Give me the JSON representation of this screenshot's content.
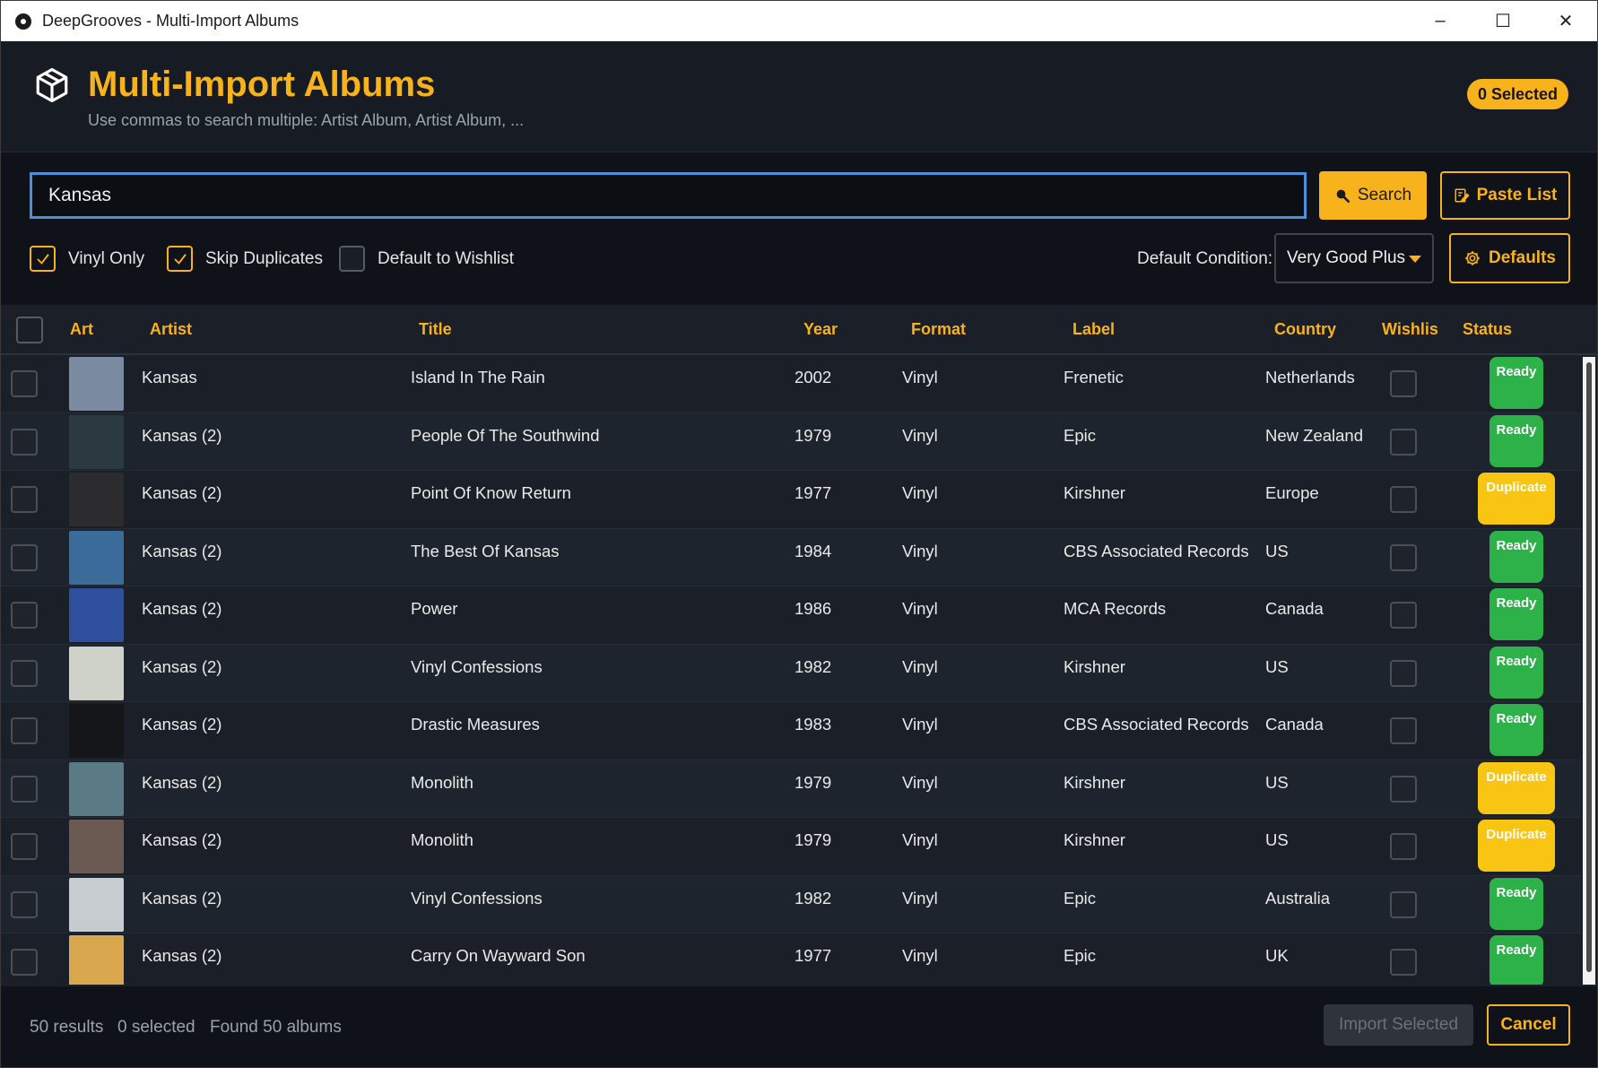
{
  "window": {
    "title": "DeepGrooves - Multi-Import Albums",
    "controls": {
      "minimize": "–",
      "maximize": "☐",
      "close": "✕"
    }
  },
  "header": {
    "title": "Multi-Import Albums",
    "subtitle": "Use commas to search multiple: Artist Album, Artist Album, ...",
    "selected_badge": "0 Selected",
    "icon": "package-icon"
  },
  "search": {
    "value": "Kansas",
    "button_label": "Search",
    "paste_label": "Paste List"
  },
  "options": {
    "vinyl_only": {
      "label": "Vinyl Only",
      "checked": true
    },
    "skip_duplicates": {
      "label": "Skip Duplicates",
      "checked": true
    },
    "default_wishlist": {
      "label": "Default to Wishlist",
      "checked": false
    },
    "condition_label": "Default Condition:",
    "condition_value": "Very Good Plus",
    "defaults_label": "Defaults"
  },
  "table": {
    "headers": [
      "Art",
      "Artist",
      "Title",
      "Year",
      "Format",
      "Label",
      "Country",
      "Wishlist",
      "Status"
    ],
    "rows": [
      {
        "artist": "Kansas",
        "title": "Island In The Rain",
        "year": "2002",
        "format": "Vinyl",
        "label": "Frenetic",
        "country": "Netherlands",
        "status": "Ready",
        "art_color": "#7a8aa0"
      },
      {
        "artist": "Kansas (2)",
        "title": "People Of The Southwind",
        "year": "1979",
        "format": "Vinyl",
        "label": "Epic",
        "country": "New Zealand",
        "status": "Ready",
        "art_color": "#2a3a40"
      },
      {
        "artist": "Kansas (2)",
        "title": "Point Of Know Return",
        "year": "1977",
        "format": "Vinyl",
        "label": "Kirshner",
        "country": "Europe",
        "status": "Duplicate",
        "art_color": "#2c2c2e"
      },
      {
        "artist": "Kansas (2)",
        "title": "The Best Of Kansas",
        "year": "1984",
        "format": "Vinyl",
        "label": "CBS Associated Records",
        "country": "US",
        "status": "Ready",
        "art_color": "#3b6b9a"
      },
      {
        "artist": "Kansas (2)",
        "title": "Power",
        "year": "1986",
        "format": "Vinyl",
        "label": "MCA Records",
        "country": "Canada",
        "status": "Ready",
        "art_color": "#2d4f9e"
      },
      {
        "artist": "Kansas (2)",
        "title": "Vinyl Confessions",
        "year": "1982",
        "format": "Vinyl",
        "label": "Kirshner",
        "country": "US",
        "status": "Ready",
        "art_color": "#cfd2c8"
      },
      {
        "artist": "Kansas (2)",
        "title": "Drastic Measures",
        "year": "1983",
        "format": "Vinyl",
        "label": "CBS Associated Records",
        "country": "Canada",
        "status": "Ready",
        "art_color": "#15161a"
      },
      {
        "artist": "Kansas (2)",
        "title": "Monolith",
        "year": "1979",
        "format": "Vinyl",
        "label": "Kirshner",
        "country": "US",
        "status": "Duplicate",
        "art_color": "#5a7a86"
      },
      {
        "artist": "Kansas (2)",
        "title": "Monolith",
        "year": "1979",
        "format": "Vinyl",
        "label": "Kirshner",
        "country": "US",
        "status": "Duplicate",
        "art_color": "#6b5a52"
      },
      {
        "artist": "Kansas (2)",
        "title": "Vinyl Confessions",
        "year": "1982",
        "format": "Vinyl",
        "label": "Epic",
        "country": "Australia",
        "status": "Ready",
        "art_color": "#c6ccd0"
      },
      {
        "artist": "Kansas (2)",
        "title": "Carry On Wayward Son",
        "year": "1977",
        "format": "Vinyl",
        "label": "Epic",
        "country": "UK",
        "status": "Ready",
        "art_color": "#d9a84e"
      }
    ]
  },
  "footer": {
    "results": "50 results",
    "selected": "0 selected",
    "found": "Found 50 albums",
    "import_label": "Import Selected",
    "cancel_label": "Cancel"
  },
  "colors": {
    "accent": "#f8b21b",
    "ready": "#2db24a",
    "duplicate": "#f8c513",
    "focus": "#4a8fe0"
  }
}
